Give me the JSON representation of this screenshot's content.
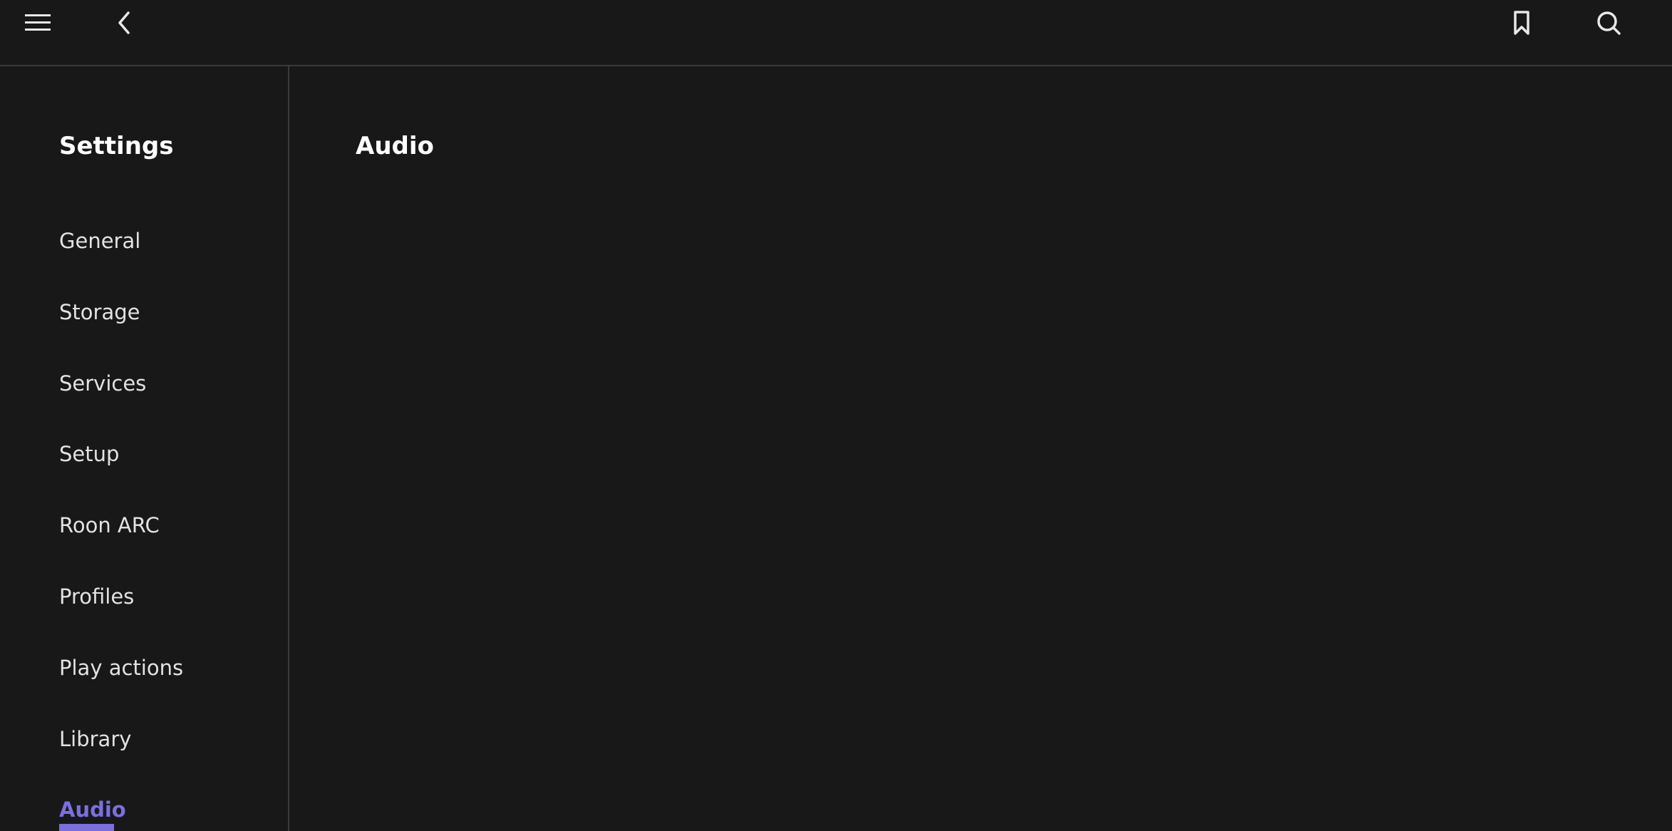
{
  "header": {
    "icons": {
      "menu": "hamburger-menu-icon",
      "back": "chevron-left-icon",
      "bookmark": "bookmark-icon",
      "search": "search-icon"
    }
  },
  "sidebar": {
    "title": "Settings",
    "items": [
      {
        "label": "General"
      },
      {
        "label": "Storage"
      },
      {
        "label": "Services"
      },
      {
        "label": "Setup"
      },
      {
        "label": "Roon ARC"
      },
      {
        "label": "Profiles"
      },
      {
        "label": "Play actions"
      },
      {
        "label": "Library"
      },
      {
        "label": "Audio"
      }
    ],
    "active_index": 8
  },
  "main": {
    "title": "Audio"
  },
  "colors": {
    "background": "#181818",
    "accent": "#7b6fe0",
    "divider": "#3a3a3a",
    "text": "#e2e2e2"
  }
}
